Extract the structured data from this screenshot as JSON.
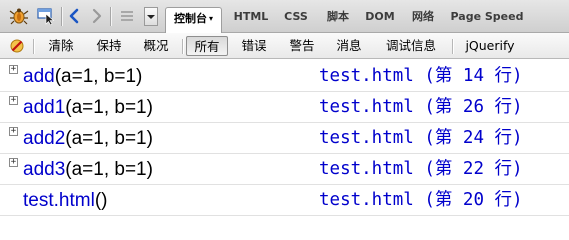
{
  "toolbar": {
    "inspect_icon": "firebug-bug-icon",
    "pointer_icon": "inspect-element-icon",
    "back_icon": "chevron-left-icon",
    "forward_icon": "chevron-right-icon",
    "menu_icon": "hamburger-icon",
    "tabs": [
      {
        "label": "控制台",
        "active": true,
        "has_dropdown": true
      },
      {
        "label": "HTML"
      },
      {
        "label": "CSS"
      },
      {
        "label": "脚本"
      },
      {
        "label": "DOM"
      },
      {
        "label": "网络"
      },
      {
        "label": "Page Speed"
      }
    ],
    "tab_dropdown_glyph": "▾"
  },
  "filters": {
    "clear_icon": "clear-console-icon",
    "items": [
      {
        "label": "清除"
      },
      {
        "label": "保持"
      },
      {
        "label": "概况"
      },
      {
        "label": "所有",
        "selected": true
      },
      {
        "label": "错误"
      },
      {
        "label": "警告"
      },
      {
        "label": "消息"
      },
      {
        "label": "调试信息"
      },
      {
        "label": "jQuerify"
      }
    ]
  },
  "console": {
    "rows": [
      {
        "name": "add",
        "args": "(a=1,  b=1)",
        "source": "test.html (第 14 行)",
        "expandable": true
      },
      {
        "name": "add1",
        "args": "(a=1,  b=1)",
        "source": "test.html (第 26 行)",
        "expandable": true
      },
      {
        "name": "add2",
        "args": "(a=1,  b=1)",
        "source": "test.html (第 24 行)",
        "expandable": true
      },
      {
        "name": "add3",
        "args": "(a=1,  b=1)",
        "source": "test.html (第 22 行)",
        "expandable": true
      },
      {
        "name": "test.html",
        "args": "()",
        "source": "test.html (第 20 行)",
        "expandable": false
      }
    ],
    "expander_glyph": "+"
  }
}
